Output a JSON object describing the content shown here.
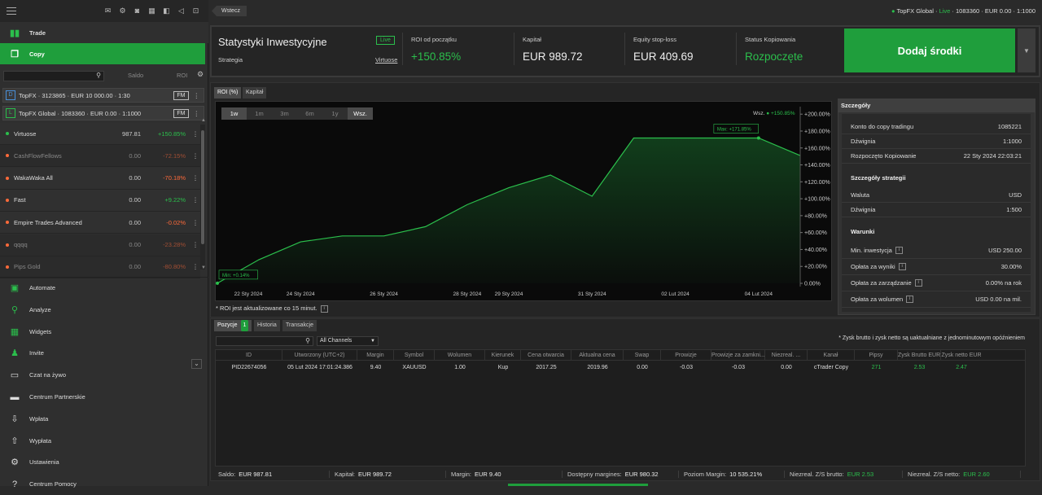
{
  "sidebar": {
    "nav_top": [
      {
        "label": "Trade",
        "icon": "candles-icon"
      },
      {
        "label": "Copy",
        "icon": "copy-icon"
      }
    ],
    "search_placeholder": "",
    "col_saldo": "Saldo",
    "col_roi": "ROI",
    "accounts": [
      {
        "badge": "D",
        "label": "TopFX · 3123865 · EUR 10 000.00 · 1:30",
        "fm": "FM",
        "color": "#4a90d9"
      },
      {
        "badge": "L",
        "label": "TopFX Global · 1083360 · EUR 0.00 · 1:1000",
        "fm": "FM",
        "color": "#2bbf4c"
      }
    ],
    "strategies": [
      {
        "name": "Virtuose",
        "saldo": "987.81",
        "roi": "+150.85%",
        "roi_color": "#2bbf4c",
        "dot": "#2bbf4c",
        "dim": false
      },
      {
        "name": "CashFlowFellows",
        "saldo": "0.00",
        "roi": "-72.15%",
        "roi_color": "#ff6a3a",
        "dot": "#ff6a3a",
        "dim": true
      },
      {
        "name": "WakaWaka All",
        "saldo": "0.00",
        "roi": "-70.18%",
        "roi_color": "#ff6a3a",
        "dot": "#ff6a3a",
        "dim": false
      },
      {
        "name": "Fast",
        "saldo": "0.00",
        "roi": "+9.22%",
        "roi_color": "#2bbf4c",
        "dot": "#ff6a3a",
        "dim": false
      },
      {
        "name": "Empire Trades Advanced",
        "saldo": "0.00",
        "roi": "-0.02%",
        "roi_color": "#ff6a3a",
        "dot": "#ff6a3a",
        "dim": false
      },
      {
        "name": "qqqq",
        "saldo": "0.00",
        "roi": "-23.28%",
        "roi_color": "#ff6a3a",
        "dot": "#ff6a3a",
        "dim": true
      },
      {
        "name": "Pips Gold",
        "saldo": "0.00",
        "roi": "-80.80%",
        "roi_color": "#ff6a3a",
        "dot": "#ff6a3a",
        "dim": true
      }
    ],
    "nav_bottom": [
      {
        "label": "Automate",
        "icon": "robot-icon"
      },
      {
        "label": "Analyze",
        "icon": "magnifier-chart-icon"
      },
      {
        "label": "Widgets",
        "icon": "widgets-icon"
      },
      {
        "label": "Invite",
        "icon": "people-icon"
      },
      {
        "label": "Czat na żywo",
        "icon": "chat-icon"
      },
      {
        "label": "Centrum Partnerskie",
        "icon": "briefcase-icon"
      },
      {
        "label": "Wpłata",
        "icon": "deposit-icon"
      },
      {
        "label": "Wypłata",
        "icon": "withdraw-icon"
      },
      {
        "label": "Ustawienia",
        "icon": "gear-icon"
      },
      {
        "label": "Centrum Pomocy",
        "icon": "help-icon"
      }
    ]
  },
  "topbar": {
    "back_label": "Wstecz",
    "account_name": "TopFX Global",
    "account_sep": " · ",
    "live": "Live",
    "account_rest": " · 1083360 · EUR 0.00 · 1:1000"
  },
  "stats": {
    "title": "Statystyki Inwestycyjne",
    "subtitle": "Strategia",
    "live_tag": "Live",
    "strategy_link": "Virtuose",
    "roi_label": "ROI od początku",
    "roi_value": "+150.85%",
    "capital_label": "Kapitał",
    "capital_value": "EUR 989.72",
    "equity_label": "Equity stop-loss",
    "equity_value": "EUR 409.69",
    "status_label": "Status Kopiowania",
    "status_value": "Rozpoczęte",
    "add_funds": "Dodaj środki"
  },
  "chart_tabs": [
    {
      "label": "ROI (%)",
      "active": true
    },
    {
      "label": "Kapitał",
      "active": false
    }
  ],
  "timeframes": [
    {
      "label": "1w",
      "on": true
    },
    {
      "label": "1m",
      "on": false
    },
    {
      "label": "3m",
      "on": false
    },
    {
      "label": "6m",
      "on": false
    },
    {
      "label": "1y",
      "on": false
    },
    {
      "label": "Wsz.",
      "on": true
    }
  ],
  "chart_legend": {
    "label": "Wsz.",
    "value": "+150.85%"
  },
  "chart_data": {
    "type": "area",
    "x": [
      "22 Sty 2024",
      "23 Sty 2024",
      "24 Sty 2024",
      "25 Sty 2024",
      "26 Sty 2024",
      "27 Sty 2024",
      "28 Sty 2024",
      "29 Sty 2024",
      "30 Sty 2024",
      "31 Sty 2024",
      "01 Lut 2024",
      "02 Lut 2024",
      "03 Lut 2024",
      "04 Lut 2024",
      "05 Lut 2024"
    ],
    "x_tick_labels": [
      "22 Sty 2024",
      "24 Sty 2024",
      "26 Sty 2024",
      "28 Sty 2024",
      "29 Sty 2024",
      "31 Sty 2024",
      "02 Lut 2024",
      "04 Lut 2024"
    ],
    "series": [
      {
        "values": [
          0.14,
          28,
          49,
          56,
          56,
          67,
          93,
          113,
          128,
          103,
          171.8,
          171.8,
          171.8,
          171.8,
          151
        ]
      }
    ],
    "ylim": [
      0,
      205
    ],
    "y_ticks": [
      0,
      20,
      40,
      60,
      80,
      100,
      120,
      140,
      160,
      180,
      200
    ],
    "y_tick_labels": [
      "0.00%",
      "+20.00%",
      "+40.00%",
      "+60.00%",
      "+80.00%",
      "+100.00%",
      "+120.00%",
      "+140.00%",
      "+160.00%",
      "+180.00%",
      "+200.00%"
    ],
    "min_label": "Min: +0.14%",
    "max_label": "Max: +171.85%",
    "grid": false,
    "line_color": "#2bbf4c"
  },
  "roi_note": "* ROI jest aktualizowane co 15 minut.",
  "details": {
    "title": "Szczegóły",
    "rows1": [
      {
        "k": "Konto do copy tradingu",
        "v": "1085221"
      },
      {
        "k": "Dźwignia",
        "v": "1:1000"
      },
      {
        "k": "Rozpoczęto Kopiowanie",
        "v": "22 Sty 2024 22:03:21"
      }
    ],
    "section2": "Szczegóły strategii",
    "rows2": [
      {
        "k": "Waluta",
        "v": "USD"
      },
      {
        "k": "Dźwignia",
        "v": "1:500"
      }
    ],
    "section3": "Warunki",
    "rows3": [
      {
        "k": "Min. inwestycja",
        "v": "USD 250.00"
      },
      {
        "k": "Opłata za wyniki",
        "v": "30.00%"
      },
      {
        "k": "Opłata za zarządzanie",
        "v": "0.00% na rok"
      },
      {
        "k": "Opłata za wolumen",
        "v": "USD 0.00 na mil."
      }
    ]
  },
  "pos_tabs": [
    {
      "label": "Pozycje",
      "count": "1",
      "active": true
    },
    {
      "label": "Historia",
      "active": false
    },
    {
      "label": "Transakcje",
      "active": false
    }
  ],
  "channels": "All Channels",
  "pos_note": "* Zysk brutto i zysk netto są uaktualniane z jednominutowym opóźnieniem",
  "positions": {
    "headers": [
      "ID",
      "Utworzony (UTC+2)",
      "Margin",
      "Symbol",
      "Wolumen",
      "Kierunek",
      "Cena otwarcia",
      "Aktualna cena",
      "Swap",
      "Prowizje",
      "Prowizje za zamkni...",
      "Niezreal. ...",
      "Kanał",
      "Pipsy",
      "Zysk Brutto EUR",
      "Zysk netto EUR"
    ],
    "rows": [
      [
        "PID22674056",
        "05 Lut 2024 17:01:24.386",
        "9.40",
        "XAUUSD",
        "1.00",
        "Kup",
        "2017.25",
        "2019.96",
        "0.00",
        "-0.03",
        "-0.03",
        "0.00",
        "cTrader Copy",
        "271",
        "2.53",
        "2.47"
      ]
    ]
  },
  "footer": [
    {
      "k": "Saldo:",
      "v": "EUR 987.81",
      "g": false
    },
    {
      "k": "Kapitał:",
      "v": "EUR 989.72",
      "g": false
    },
    {
      "k": "Margin:",
      "v": "EUR 9.40",
      "g": false
    },
    {
      "k": "Dostępny margines:",
      "v": "EUR 980.32",
      "g": false
    },
    {
      "k": "Poziom Margin:",
      "v": "10 535.21%",
      "g": false
    },
    {
      "k": "Niezreal. Z/S brutto:",
      "v": "EUR 2.53",
      "g": true
    },
    {
      "k": "Niezreal. Z/S netto:",
      "v": "EUR 2.60",
      "g": true
    }
  ]
}
